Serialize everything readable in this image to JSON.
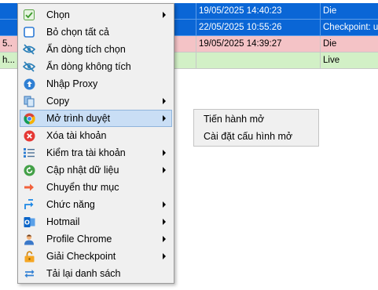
{
  "grid": {
    "rows": [
      {
        "style": "selected",
        "prefix": "",
        "date": "19/05/2025 14:40:23",
        "status": "Die"
      },
      {
        "style": "selected",
        "prefix": "",
        "date": "22/05/2025 10:55:26",
        "status": "Checkpoint: ur"
      },
      {
        "style": "pink",
        "prefix": "5..",
        "date": "19/05/2025 14:39:27",
        "status": "Die"
      },
      {
        "style": "green",
        "prefix": "h...",
        "date": "",
        "status": "Live"
      }
    ]
  },
  "context_menu": {
    "items": [
      {
        "label": "Chọn",
        "icon": "checkbox-checked-icon",
        "submenu": true
      },
      {
        "label": "Bỏ chọn tất cả",
        "icon": "checkbox-empty-icon",
        "submenu": false
      },
      {
        "label": "Ẩn dòng tích chọn",
        "icon": "eye-hidden-icon",
        "submenu": false
      },
      {
        "label": "Ẩn dòng không tích",
        "icon": "eye-hidden-icon",
        "submenu": false
      },
      {
        "label": "Nhập Proxy",
        "icon": "upload-circle-icon",
        "submenu": false
      },
      {
        "label": "Copy",
        "icon": "copy-icon",
        "submenu": true
      },
      {
        "label": "Mở trình duyệt",
        "icon": "chrome-icon",
        "submenu": true,
        "active": true
      },
      {
        "label": "Xóa tài khoản",
        "icon": "delete-circle-icon",
        "submenu": false
      },
      {
        "label": "Kiểm tra tài khoản",
        "icon": "checklist-icon",
        "submenu": true
      },
      {
        "label": "Cập nhật dữ liệu",
        "icon": "refresh-circle-icon",
        "submenu": true
      },
      {
        "label": "Chuyển thư mục",
        "icon": "arrow-right-icon",
        "submenu": false
      },
      {
        "label": "Chức năng",
        "icon": "function-arrow-icon",
        "submenu": true
      },
      {
        "label": "Hotmail",
        "icon": "outlook-icon",
        "submenu": true
      },
      {
        "label": "Profile Chrome",
        "icon": "user-profile-icon",
        "submenu": true
      },
      {
        "label": "Giải Checkpoint",
        "icon": "unlock-icon",
        "submenu": true
      },
      {
        "label": "Tải lại danh sách",
        "icon": "reload-arrows-icon",
        "submenu": false
      }
    ]
  },
  "submenu": {
    "items": [
      {
        "label": "Tiến hành mở"
      },
      {
        "label": "Cài đặt cấu hình mở"
      }
    ]
  },
  "colors": {
    "selected_row": "#0a66d6",
    "pink_row": "#f4c3c6",
    "green_row": "#d2f0c6",
    "menu_bg": "#f0f0f0",
    "menu_highlight": "#c9def5"
  }
}
